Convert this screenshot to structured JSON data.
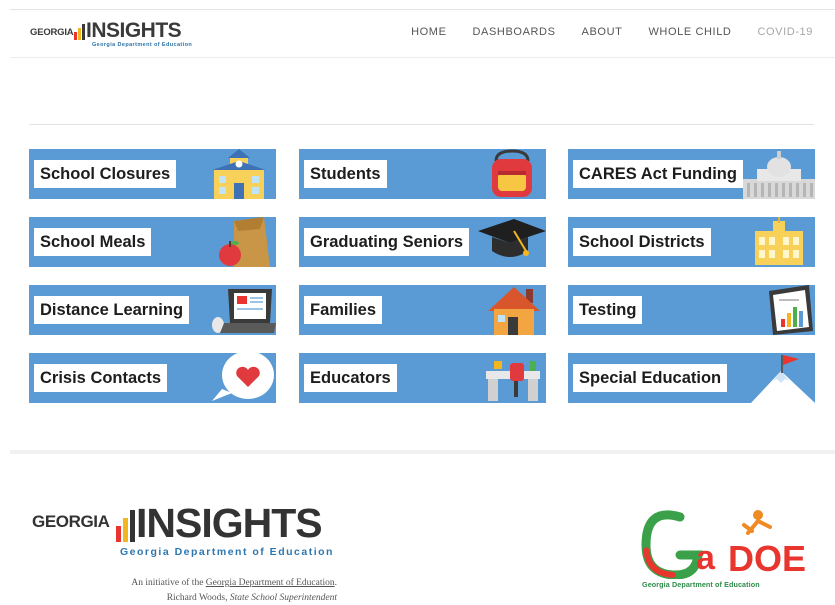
{
  "brand": {
    "logo_georgia": "GEORGIA",
    "logo_insights": "INSIGHTS",
    "logo_sub": "Georgia Department of Education"
  },
  "nav": {
    "home": "HOME",
    "dashboards": "DASHBOARDS",
    "about": "ABOUT",
    "whole_child": "WHOLE CHILD",
    "covid": "COVID-19"
  },
  "tiles": [
    {
      "label": "School Closures",
      "icon": "school-building-icon"
    },
    {
      "label": "Students",
      "icon": "backpack-icon"
    },
    {
      "label": "CARES Act Funding",
      "icon": "capitol-building-icon"
    },
    {
      "label": "School Meals",
      "icon": "lunch-bag-apple-icon"
    },
    {
      "label": "Graduating Seniors",
      "icon": "graduation-cap-icon"
    },
    {
      "label": "School Districts",
      "icon": "district-building-icon"
    },
    {
      "label": "Distance Learning",
      "icon": "laptop-icon"
    },
    {
      "label": "Families",
      "icon": "house-icon"
    },
    {
      "label": "Testing",
      "icon": "clipboard-chart-icon"
    },
    {
      "label": "Crisis Contacts",
      "icon": "heart-speech-bubble-icon"
    },
    {
      "label": "Educators",
      "icon": "teacher-desk-icon"
    },
    {
      "label": "Special Education",
      "icon": "mountain-flag-icon"
    }
  ],
  "footer": {
    "logo_georgia": "GEORGIA",
    "logo_insights": "INSIGHTS",
    "logo_sub": "Georgia Department of Education",
    "initiative_prefix": "An initiative of the ",
    "initiative_link": "Georgia Department of Education",
    "initiative_suffix": ".",
    "superintendent_name": "Richard Woods, ",
    "superintendent_title": "State School Superintendent",
    "gadoe_text": "Georgia Department of Education"
  },
  "colors": {
    "tile_blue": "#5b9bd5",
    "brand_blue": "#2c73a8",
    "gadoe_green": "#2e8b4a",
    "gadoe_red": "#e23b3b"
  }
}
